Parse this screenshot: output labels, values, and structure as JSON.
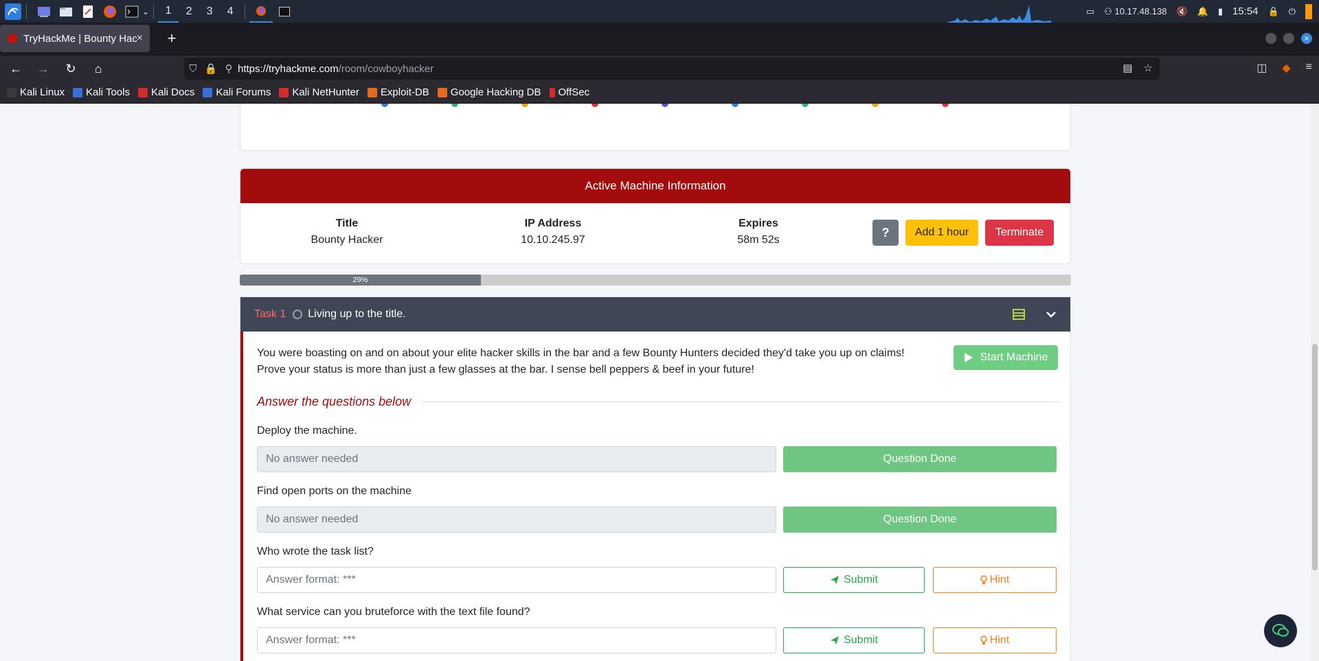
{
  "panel": {
    "workspaces": [
      "1",
      "2",
      "3",
      "4"
    ],
    "ip": "10.17.48.138",
    "clock": "15:54"
  },
  "tab": {
    "title": "TryHackMe | Bounty Hacker",
    "close": "×"
  },
  "newtab": "+",
  "url": {
    "host": "https://tryhackme.com",
    "path": "/room/cowboyhacker"
  },
  "bookmarks": [
    {
      "label": "Kali Linux",
      "color": "#3a3a3a"
    },
    {
      "label": "Kali Tools",
      "color": "#3a6fd8"
    },
    {
      "label": "Kali Docs",
      "color": "#d42c2c"
    },
    {
      "label": "Kali Forums",
      "color": "#3a6fd8"
    },
    {
      "label": "Kali NetHunter",
      "color": "#d42c2c"
    },
    {
      "label": "Exploit-DB",
      "color": "#e46a1c"
    },
    {
      "label": "Google Hacking DB",
      "color": "#e46a1c"
    },
    {
      "label": "OffSec",
      "color": "#d42c2c"
    }
  ],
  "machine": {
    "header": "Active Machine Information",
    "title_label": "Title",
    "title_value": "Bounty Hacker",
    "ip_label": "IP Address",
    "ip_value": "10.10.245.97",
    "expires_label": "Expires",
    "expires_value": "58m 52s",
    "help_button": "?",
    "add_hour_button": "Add 1 hour",
    "terminate_button": "Terminate"
  },
  "progress": {
    "percent": 29,
    "label": "29%"
  },
  "task": {
    "number": "Task 1",
    "title": "Living up to the title.",
    "text_line1": "You were boasting on and on about your elite hacker skills in the bar and a few Bounty Hunters decided they'd take you up on claims!",
    "text_line2": "Prove your status is more than just a few glasses at the bar. I sense bell peppers & beef in your future!",
    "start_button": "Start Machine",
    "answer_heading": "Answer the questions below",
    "questions": [
      {
        "label": "Deploy the machine.",
        "placeholder": "No answer needed",
        "done": "Question Done"
      },
      {
        "label": "Find open ports on the machine",
        "placeholder": "No answer needed",
        "done": "Question Done"
      },
      {
        "label": "Who wrote the task list?",
        "placeholder": "Answer format: ***",
        "submit": "Submit",
        "hint": "Hint"
      },
      {
        "label": "What service can you bruteforce with the text file found?",
        "placeholder": "Answer format: ***",
        "submit": "Submit",
        "hint": "Hint"
      }
    ]
  },
  "colors": {
    "accent_red": "#a30c0c",
    "success": "#28a745",
    "warning": "#fd7e14"
  }
}
